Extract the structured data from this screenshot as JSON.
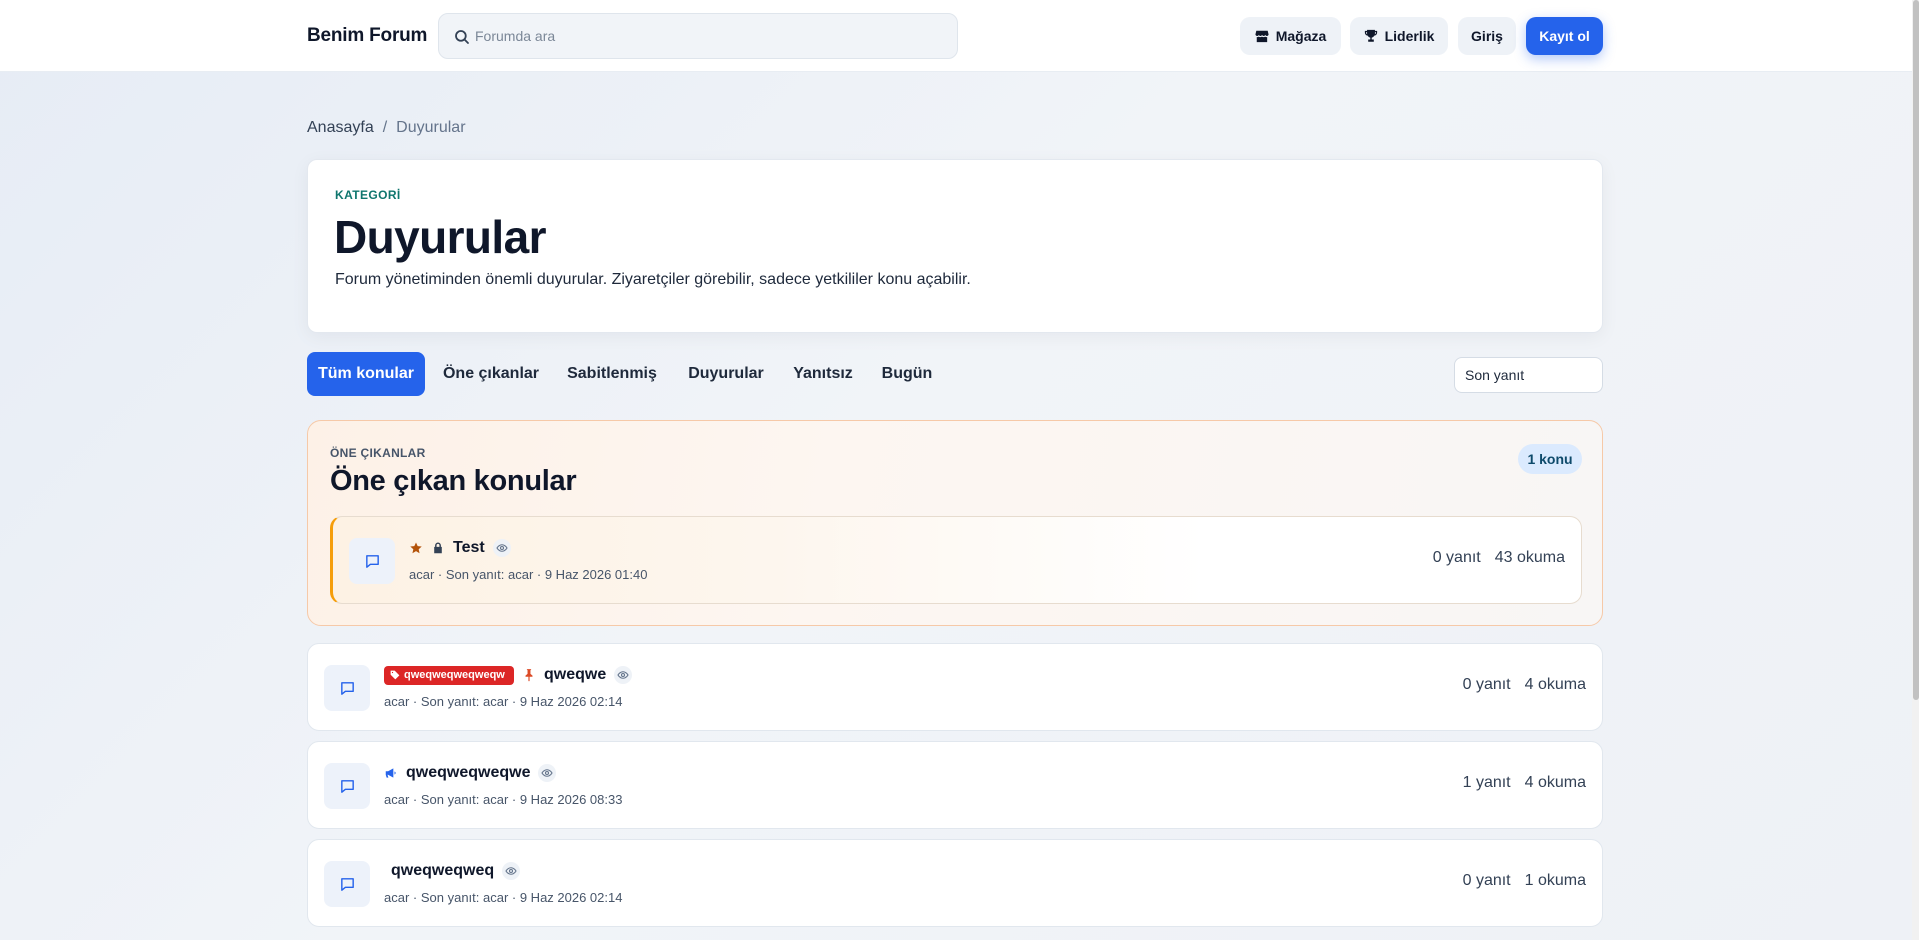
{
  "header": {
    "brand": "Benim Forum",
    "search_placeholder": "Forumda ara",
    "shop_label": "Mağaza",
    "leaderboard_label": "Liderlik",
    "login_label": "Giriş",
    "register_label": "Kayıt ol"
  },
  "breadcrumb": {
    "home": "Anasayfa",
    "separator": "/",
    "current": "Duyurular"
  },
  "category": {
    "eyebrow": "KATEGORİ",
    "title": "Duyurular",
    "description": "Forum yönetiminden önemli duyurular. Ziyaretçiler görebilir, sadece yetkililer konu açabilir."
  },
  "tabs": [
    "Tüm konular",
    "Öne çıkanlar",
    "Sabitlenmiş",
    "Duyurular",
    "Yanıtsız",
    "Bugün"
  ],
  "active_tab": "Tüm konular",
  "sort": {
    "selected": "Son yanıt"
  },
  "featured": {
    "eyebrow": "ÖNE ÇIKANLAR",
    "title": "Öne çıkan konular",
    "count_badge": "1 konu",
    "threads": [
      {
        "title": "Test",
        "meta": "acar · Son yanıt: acar · 9 Haz 2026 01:40",
        "replies": "0 yanıt",
        "views": "43 okuma",
        "icons": [
          "star-icon",
          "lock-icon",
          "eye-icon"
        ]
      }
    ]
  },
  "threads": [
    {
      "tag": "qweqweqweqweqw",
      "title": "qweqwe",
      "meta": "acar · Son yanıt: acar · 9 Haz 2026 02:14",
      "replies": "0 yanıt",
      "views": "4 okuma",
      "icons": [
        "pin-icon",
        "eye-icon"
      ]
    },
    {
      "title": "qweqweqweqwe",
      "meta": "acar · Son yanıt: acar · 9 Haz 2026 08:33",
      "replies": "1 yanıt",
      "views": "4 okuma",
      "icons": [
        "megaphone-icon",
        "eye-icon"
      ]
    },
    {
      "title": "qweqweqweq",
      "meta": "acar · Son yanıt: acar · 9 Haz 2026 02:14",
      "replies": "0 yanıt",
      "views": "1 okuma",
      "icons": [
        "eye-icon"
      ]
    }
  ],
  "colors": {
    "accent": "#2563eb",
    "featured_border": "#f59e0b",
    "tag_red": "#dc2626",
    "eyebrow_teal": "#0f766e"
  }
}
